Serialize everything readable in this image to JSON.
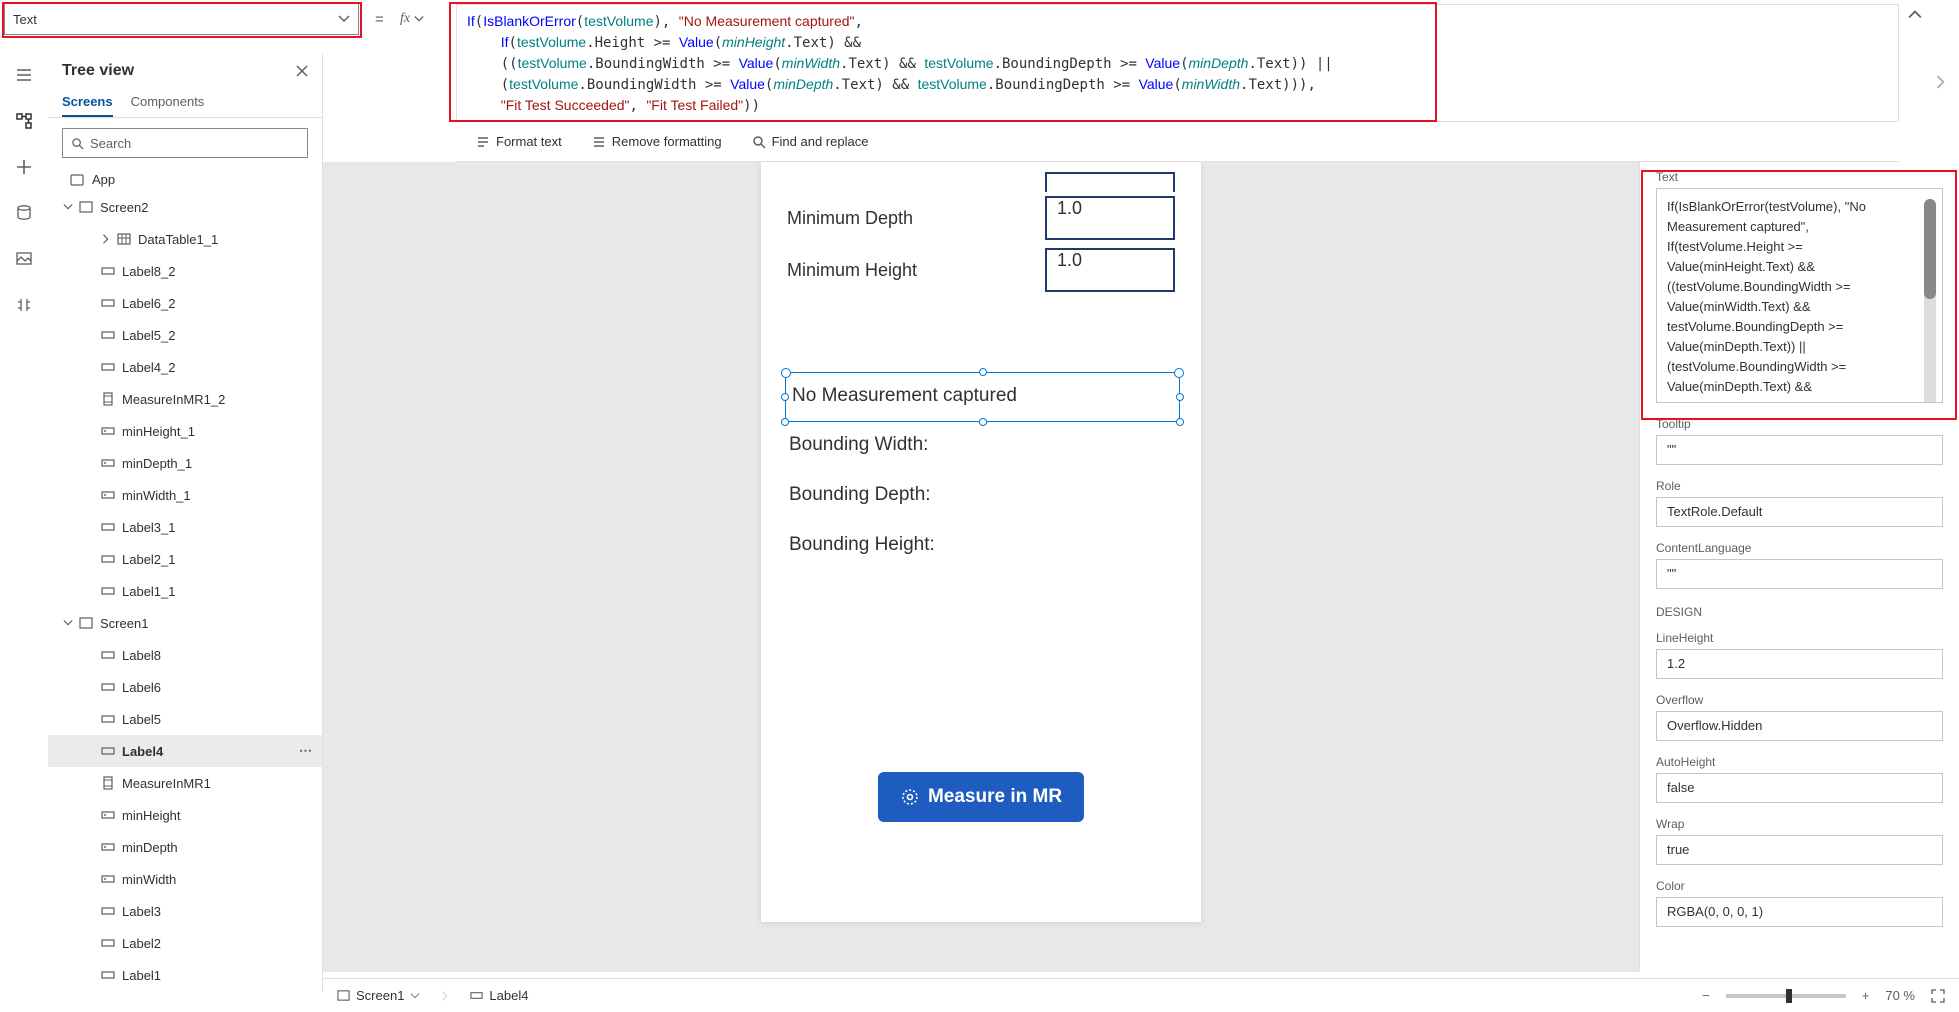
{
  "topbar": {
    "property": "Text",
    "equals": "=",
    "fx": "fx",
    "formula_html": "<span class='tok-fn'>If</span>(<span class='tok-fn'>IsBlankOrError</span>(<span class='tok-var'>testVolume</span>), <span class='tok-str'>\"No Measurement captured\"</span>,\n    <span class='tok-fn'>If</span>(<span class='tok-var'>testVolume</span>.Height &gt;= <span class='tok-fn'>Value</span>(<span class='tok-varit'>minHeight</span>.Text) &amp;&amp;\n    ((<span class='tok-var'>testVolume</span>.BoundingWidth &gt;= <span class='tok-fn'>Value</span>(<span class='tok-varit'>minWidth</span>.Text) &amp;&amp; <span class='tok-var'>testVolume</span>.BoundingDepth &gt;= <span class='tok-fn'>Value</span>(<span class='tok-varit'>minDepth</span>.Text)) ||\n    (<span class='tok-var'>testVolume</span>.BoundingWidth &gt;= <span class='tok-fn'>Value</span>(<span class='tok-varit'>minDepth</span>.Text) &amp;&amp; <span class='tok-var'>testVolume</span>.BoundingDepth &gt;= <span class='tok-fn'>Value</span>(<span class='tok-varit'>minWidth</span>.Text))),\n    <span class='tok-str'>\"Fit Test Succeeded\"</span>, <span class='tok-str'>\"Fit Test Failed\"</span>))"
  },
  "subbar": {
    "format": "Format text",
    "remove": "Remove formatting",
    "find": "Find and replace"
  },
  "tree": {
    "title": "Tree view",
    "screens_tab": "Screens",
    "components_tab": "Components",
    "search": "Search",
    "app": "App",
    "items": [
      {
        "lvl": 1,
        "exp": "down",
        "ic": "screen",
        "label": "Screen2"
      },
      {
        "lvl": 2,
        "exp": "right",
        "ic": "table",
        "label": "DataTable1_1"
      },
      {
        "lvl": 2,
        "ic": "label",
        "label": "Label8_2"
      },
      {
        "lvl": 2,
        "ic": "label",
        "label": "Label6_2"
      },
      {
        "lvl": 2,
        "ic": "label",
        "label": "Label5_2"
      },
      {
        "lvl": 2,
        "ic": "label",
        "label": "Label4_2"
      },
      {
        "lvl": 2,
        "ic": "mr",
        "label": "MeasureInMR1_2"
      },
      {
        "lvl": 2,
        "ic": "input",
        "label": "minHeight_1"
      },
      {
        "lvl": 2,
        "ic": "input",
        "label": "minDepth_1"
      },
      {
        "lvl": 2,
        "ic": "input",
        "label": "minWidth_1"
      },
      {
        "lvl": 2,
        "ic": "label",
        "label": "Label3_1"
      },
      {
        "lvl": 2,
        "ic": "label",
        "label": "Label2_1"
      },
      {
        "lvl": 2,
        "ic": "label",
        "label": "Label1_1"
      },
      {
        "lvl": 1,
        "exp": "down",
        "ic": "screen",
        "label": "Screen1"
      },
      {
        "lvl": 2,
        "ic": "label",
        "label": "Label8"
      },
      {
        "lvl": 2,
        "ic": "label",
        "label": "Label6"
      },
      {
        "lvl": 2,
        "ic": "label",
        "label": "Label5"
      },
      {
        "lvl": 2,
        "ic": "label",
        "label": "Label4",
        "sel": true,
        "dots": true
      },
      {
        "lvl": 2,
        "ic": "mr",
        "label": "MeasureInMR1"
      },
      {
        "lvl": 2,
        "ic": "input",
        "label": "minHeight"
      },
      {
        "lvl": 2,
        "ic": "input",
        "label": "minDepth"
      },
      {
        "lvl": 2,
        "ic": "input",
        "label": "minWidth"
      },
      {
        "lvl": 2,
        "ic": "label",
        "label": "Label3"
      },
      {
        "lvl": 2,
        "ic": "label",
        "label": "Label2"
      },
      {
        "lvl": 2,
        "ic": "label",
        "label": "Label1"
      }
    ]
  },
  "canvas": {
    "min_depth_label": "Minimum Depth",
    "min_depth_value": "1.0",
    "min_height_label": "Minimum Height",
    "min_height_value": "1.0",
    "result": "No Measurement captured",
    "bwidth": "Bounding Width:",
    "bdepth": "Bounding Depth:",
    "bheight": "Bounding Height:",
    "mr_button": "Measure in MR"
  },
  "rightpanel": {
    "text_label": "Text",
    "text_value": "If(IsBlankOrError(testVolume), \"No\nMeasurement captured\",\nIf(testVolume.Height >=\nValue(minHeight.Text) &&\n((testVolume.BoundingWidth >=\nValue(minWidth.Text) &&\ntestVolume.BoundingDepth >=\nValue(minDepth.Text)) ||\n(testVolume.BoundingWidth >=\nValue(minDepth.Text) &&",
    "tooltip_label": "Tooltip",
    "tooltip_value": "\"\"",
    "role_label": "Role",
    "role_value": "TextRole.Default",
    "lang_label": "ContentLanguage",
    "lang_value": "\"\"",
    "design": "DESIGN",
    "lineheight_label": "LineHeight",
    "lineheight_value": "1.2",
    "overflow_label": "Overflow",
    "overflow_value": "Overflow.Hidden",
    "autoheight_label": "AutoHeight",
    "autoheight_value": "false",
    "wrap_label": "Wrap",
    "wrap_value": "true",
    "color_label": "Color",
    "color_value": "RGBA(0, 0, 0, 1)"
  },
  "bottombar": {
    "screen": "Screen1",
    "control": "Label4",
    "zoom": "70 %"
  }
}
